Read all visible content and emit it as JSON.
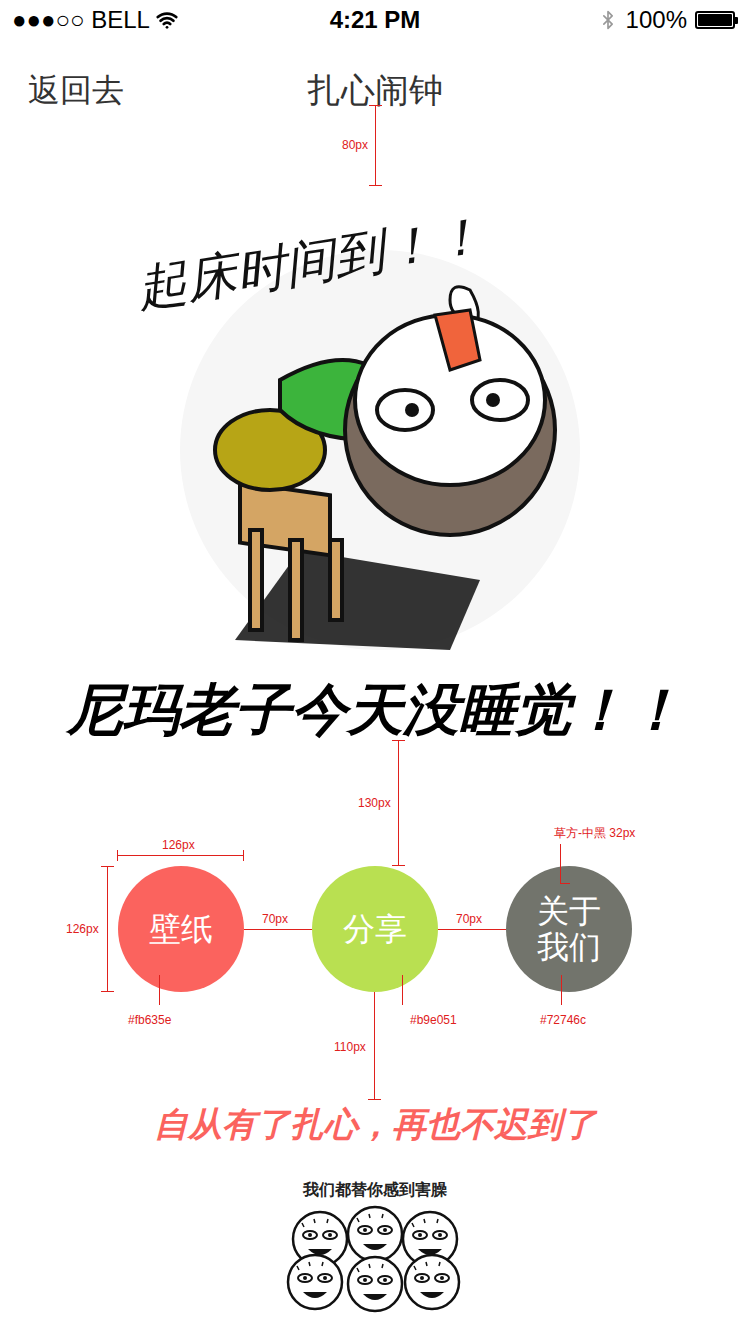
{
  "status_bar": {
    "carrier": "●●●○○ BELL",
    "time": "4:21 PM",
    "battery": "100%"
  },
  "nav": {
    "back": "返回去",
    "title": "扎心闹钟"
  },
  "illustration": {
    "caption": "起床时间到！！"
  },
  "headline": "尼玛老子今天没睡觉！！",
  "buttons": [
    {
      "label": "壁纸",
      "color": "#fb635e"
    },
    {
      "label": "分享",
      "color": "#b9e051"
    },
    {
      "label": "关于我们",
      "color": "#72746c"
    }
  ],
  "slogan": "自从有了扎心，再也不迟到了",
  "footer": {
    "caption": "我们都替你感到害臊"
  },
  "annotations": {
    "title_gap": "80px",
    "headline_gap": "130px",
    "button_width": "126px",
    "button_height": "126px",
    "button_gap_left": "70px",
    "button_gap_right": "70px",
    "slogan_gap": "110px",
    "font_note": "草方-中黑 32px"
  }
}
